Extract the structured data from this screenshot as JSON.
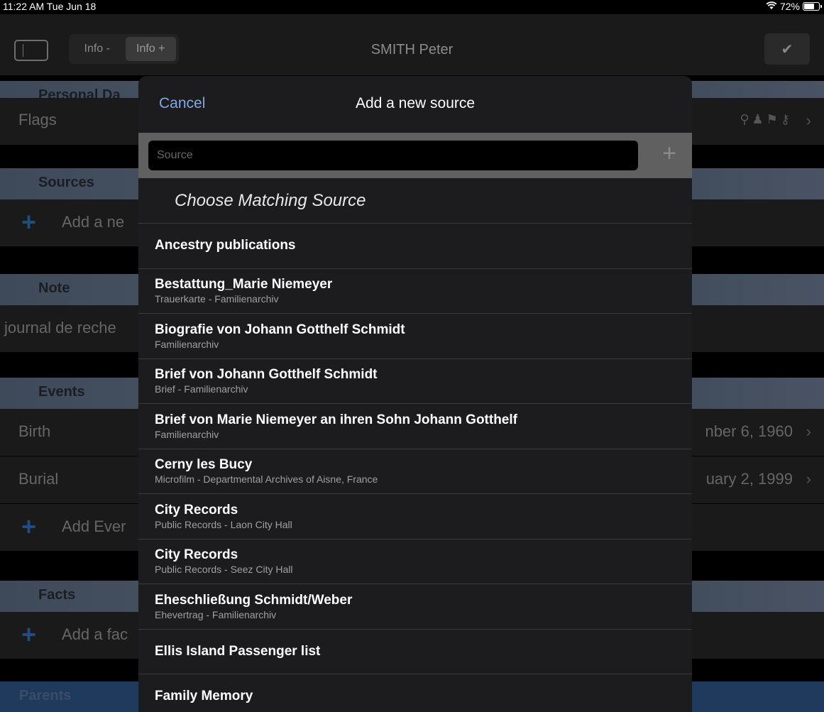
{
  "status": {
    "time": "11:22 AM  Tue Jun 18",
    "battery": "72%"
  },
  "nav": {
    "segment_minus": "Info -",
    "segment_plus": "Info +",
    "title": "SMITH Peter",
    "check": "✔"
  },
  "background": {
    "personal_data": "Personal Da",
    "flags": "Flags",
    "sources": "Sources",
    "add_source": "Add a ne",
    "note": "Note",
    "note_text": "journal de reche",
    "events": "Events",
    "birth": "Birth",
    "birth_date": "nber 6, 1960",
    "burial": "Burial",
    "burial_date": "uary 2, 1999",
    "add_event": "Add Ever",
    "facts": "Facts",
    "add_fact": "Add a fac",
    "parents": "Parents"
  },
  "modal": {
    "cancel": "Cancel",
    "title": "Add a new source",
    "search_placeholder": "Source",
    "choose_label": "Choose Matching Source",
    "items": [
      {
        "title": "Ancestry publications",
        "sub": ""
      },
      {
        "title": "Bestattung_Marie Niemeyer",
        "sub": "Trauerkarte - Familienarchiv"
      },
      {
        "title": "Biografie von Johann Gotthelf Schmidt",
        "sub": "Familienarchiv"
      },
      {
        "title": "Brief von Johann Gotthelf Schmidt",
        "sub": "Brief - Familienarchiv"
      },
      {
        "title": "Brief von Marie Niemeyer an ihren Sohn Johann Gotthelf",
        "sub": "Familienarchiv"
      },
      {
        "title": "Cerny les Bucy",
        "sub": "Microfilm - Departmental Archives of Aisne, France"
      },
      {
        "title": "City Records",
        "sub": "Public Records - Laon City Hall"
      },
      {
        "title": "City Records",
        "sub": "Public Records - Seez City Hall"
      },
      {
        "title": "Eheschließung Schmidt/Weber",
        "sub": "Ehevertrag - Familienarchiv"
      },
      {
        "title": "Ellis Island Passenger list",
        "sub": ""
      },
      {
        "title": "Family Memory",
        "sub": ""
      }
    ]
  }
}
